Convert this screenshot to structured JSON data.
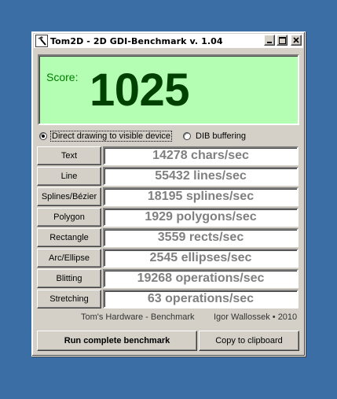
{
  "window": {
    "title": "Tom2D - 2D GDI-Benchmark v. 1.04",
    "icons": {
      "app": "hammer-icon",
      "minimize": "minimize-icon",
      "maximize": "maximize-icon",
      "close": "close-icon"
    }
  },
  "score": {
    "label": "Score:",
    "value": "1025"
  },
  "mode": {
    "options": [
      {
        "label": "Direct drawing to visible device",
        "selected": true
      },
      {
        "label": "DIB buffering",
        "selected": false
      }
    ]
  },
  "benchmarks": [
    {
      "label": "Text",
      "result": "14278 chars/sec"
    },
    {
      "label": "Line",
      "result": "55432 lines/sec"
    },
    {
      "label": "Splines/Bézier",
      "result": "18195 splines/sec"
    },
    {
      "label": "Polygon",
      "result": "1929 polygons/sec"
    },
    {
      "label": "Rectangle",
      "result": "3559 rects/sec"
    },
    {
      "label": "Arc/Ellipse",
      "result": "2545 ellipses/sec"
    },
    {
      "label": "Blitting",
      "result": "19268 operations/sec"
    },
    {
      "label": "Stretching",
      "result": "63 operations/sec"
    }
  ],
  "credits": {
    "left": "Tom's Hardware - Benchmark",
    "right": "Igor Wallossek • 2010"
  },
  "actions": {
    "run": "Run complete benchmark",
    "copy": "Copy to clipboard"
  },
  "colors": {
    "desktop": "#3a6ea5",
    "score_bg": "#b4feb4",
    "score_label": "#008000",
    "score_value": "#004000",
    "result_text": "#808080"
  }
}
